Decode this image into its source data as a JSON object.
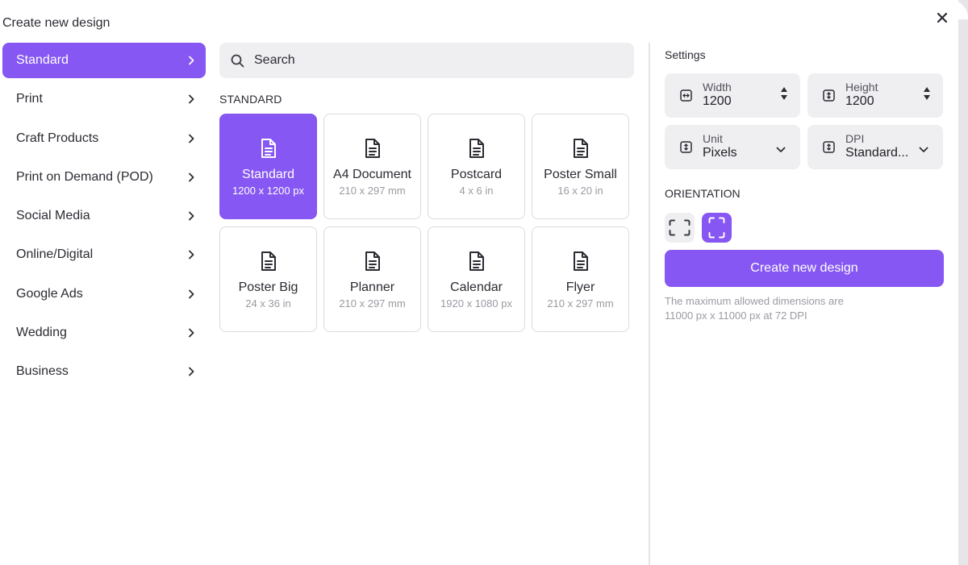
{
  "dialog": {
    "title": "Create new design",
    "close_icon": "close-icon"
  },
  "colors": {
    "accent": "#8657f2",
    "field_bg": "#efeff2",
    "border": "#dcdce1"
  },
  "sidebar": {
    "items": [
      {
        "label": "Standard"
      },
      {
        "label": "Print"
      },
      {
        "label": "Craft Products"
      },
      {
        "label": "Print on Demand (POD)"
      },
      {
        "label": "Social Media"
      },
      {
        "label": "Online/Digital"
      },
      {
        "label": "Google Ads"
      },
      {
        "label": "Wedding"
      },
      {
        "label": "Business"
      }
    ]
  },
  "search": {
    "placeholder": "Search"
  },
  "section": {
    "label": "STANDARD"
  },
  "templates": [
    {
      "name": "Standard",
      "dims": "1200 x 1200 px"
    },
    {
      "name": "A4 Document",
      "dims": "210 x 297 mm"
    },
    {
      "name": "Postcard",
      "dims": "4 x 6 in"
    },
    {
      "name": "Poster Small",
      "dims": "16 x 20 in"
    },
    {
      "name": "Poster Big",
      "dims": "24 x 36 in"
    },
    {
      "name": "Planner",
      "dims": "210 x 297 mm"
    },
    {
      "name": "Calendar",
      "dims": "1920 x 1080 px"
    },
    {
      "name": "Flyer",
      "dims": "210 x 297 mm"
    }
  ],
  "settings": {
    "title": "Settings",
    "width": {
      "label": "Width",
      "value": "1200"
    },
    "height": {
      "label": "Height",
      "value": "1200"
    },
    "unit": {
      "label": "Unit",
      "value": "Pixels"
    },
    "dpi": {
      "label": "DPI",
      "value": "Standard..."
    },
    "orientation_label": "ORIENTATION",
    "create_label": "Create new design",
    "hint_line1": "The maximum allowed dimensions are",
    "hint_line2": "11000 px x 11000 px at 72 DPI"
  }
}
